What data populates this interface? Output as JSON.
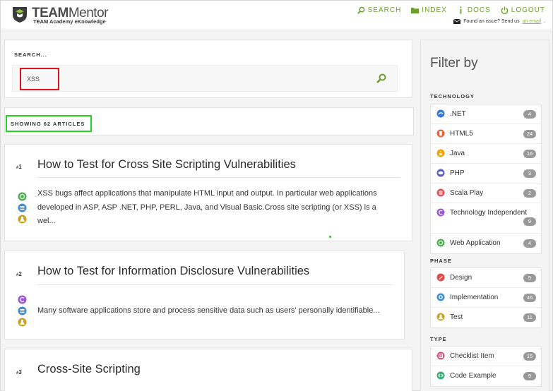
{
  "header": {
    "brand_bold": "TEAM",
    "brand_light": "Mentor",
    "tagline": "TEAM Academy eKnowledge",
    "nav": [
      {
        "label": "SEARCH",
        "icon": "search-icon"
      },
      {
        "label": "INDEX",
        "icon": "folder-icon"
      },
      {
        "label": "DOCS",
        "icon": "info-icon"
      },
      {
        "label": "LOGOUT",
        "icon": "power-icon"
      }
    ],
    "issue_text": "Found an issue? Send us",
    "issue_link": "an email",
    "issue_end": "."
  },
  "search": {
    "label": "SEARCH...",
    "value": "XSS"
  },
  "results": {
    "count_label": "SHOWING 62 ARTICLES"
  },
  "articles": [
    {
      "num": "1",
      "title": "How to Test for Cross Site Scripting Vulnerabilities",
      "snippet_lines": [
        "XSS bugs affect applications that manipulate HTML input and output. In particular web applications",
        "developed in ASP, ASP .NET, PHP, PERL, Java, and Visual Basic.Cross site scripting (or XSS) is a",
        "wel..."
      ],
      "icons": [
        "web-application-icon",
        "implementation-icon",
        "test-icon"
      ]
    },
    {
      "num": "2",
      "title": "How to Test for Information Disclosure Vulnerabilities",
      "snippet_lines": [
        "Many software applications store and process sensitive data such as users' personally identifiable..."
      ],
      "icons": [
        "technology-independent-icon",
        "implementation-icon",
        "test-icon"
      ]
    },
    {
      "num": "3",
      "title": "Cross-Site Scripting"
    }
  ],
  "filter": {
    "title": "Filter by",
    "sections": [
      {
        "name": "TECHNOLOGY",
        "items": [
          {
            "label": ".NET",
            "count": "4",
            "color": "#3a7bd5"
          },
          {
            "label": "HTML5",
            "count": "24",
            "color": "#e8653a"
          },
          {
            "label": "Java",
            "count": "16",
            "color": "#f0a30a"
          },
          {
            "label": "PHP",
            "count": "3",
            "color": "#5b5fc7"
          },
          {
            "label": "Scala Play",
            "count": "2",
            "color": "#e0505a"
          },
          {
            "label": "Technology Independent",
            "count": "9",
            "color": "#9b59d0"
          },
          {
            "label": "Web Application",
            "count": "4",
            "color": "#4caf50"
          }
        ]
      },
      {
        "name": "PHASE",
        "items": [
          {
            "label": "Design",
            "count": "5",
            "color": "#e04a4a"
          },
          {
            "label": "Implementation",
            "count": "46",
            "color": "#3a8fd5"
          },
          {
            "label": "Test",
            "count": "11",
            "color": "#c9a227"
          }
        ]
      },
      {
        "name": "TYPE",
        "items": [
          {
            "label": "Checklist Item",
            "count": "15",
            "color": "#e0507a"
          },
          {
            "label": "Code Example",
            "count": "9",
            "color": "#3ab07a"
          }
        ]
      }
    ]
  }
}
